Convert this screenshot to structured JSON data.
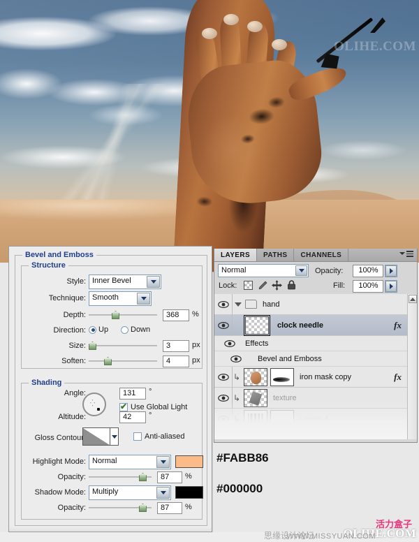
{
  "photo": {
    "description": "Desert landscape with blue cloudy sky and a rusted iron hand holding a black clock needle",
    "sky_color": "#5f7f9e",
    "sand_color": "#d2a579",
    "rust_color": "#b8743f"
  },
  "watermarks": {
    "top_right": "OLIHE.COM",
    "bottom_olihe": "OLIHE.COM",
    "bottom_huoli": "活力盒子",
    "bottom_missyuan": "WWW.MISSYUAN.COM",
    "bottom_siyuan": "思缘设计论坛"
  },
  "dialog": {
    "title": "Bevel and Emboss",
    "structure": {
      "title": "Structure",
      "style_label": "Style:",
      "style_value": "Inner Bevel",
      "technique_label": "Technique:",
      "technique_value": "Smooth",
      "depth_label": "Depth:",
      "depth_value": "368",
      "depth_unit": "%",
      "direction_label": "Direction:",
      "direction_up": "Up",
      "direction_down": "Down",
      "direction_selected": "Up",
      "size_label": "Size:",
      "size_value": "3",
      "size_unit": "px",
      "soften_label": "Soften:",
      "soften_value": "4",
      "soften_unit": "px"
    },
    "shading": {
      "title": "Shading",
      "angle_label": "Angle:",
      "angle_value": "131",
      "angle_unit": "°",
      "use_global_light_label": "Use Global Light",
      "use_global_light_checked": true,
      "altitude_label": "Altitude:",
      "altitude_value": "42",
      "altitude_unit": "°",
      "gloss_contour_label": "Gloss Contour:",
      "anti_aliased_label": "Anti-aliased",
      "anti_aliased_checked": false,
      "highlight_mode_label": "Highlight Mode:",
      "highlight_mode_value": "Normal",
      "highlight_color": "#FABB86",
      "highlight_color_hex": "#FABB86",
      "highlight_opacity_label": "Opacity:",
      "highlight_opacity_value": "87",
      "highlight_opacity_unit": "%",
      "shadow_mode_label": "Shadow Mode:",
      "shadow_mode_value": "Multiply",
      "shadow_color": "#000000",
      "shadow_color_hex": "#000000",
      "shadow_opacity_label": "Opacity:",
      "shadow_opacity_value": "87",
      "shadow_opacity_unit": "%"
    }
  },
  "layers_panel": {
    "tabs": [
      {
        "label": "LAYERS",
        "active": true
      },
      {
        "label": "PATHS",
        "active": false
      },
      {
        "label": "CHANNELS",
        "active": false
      }
    ],
    "blend_mode": "Normal",
    "opacity_label": "Opacity:",
    "opacity_value": "100%",
    "lock_label": "Lock:",
    "fill_label": "Fill:",
    "fill_value": "100%",
    "lock_icons": [
      "lock-transparent-pixels-icon",
      "lock-image-pixels-icon",
      "lock-position-icon",
      "lock-all-icon"
    ],
    "rows": [
      {
        "kind": "group",
        "name": "hand",
        "visible": true,
        "selected": false,
        "expanded": true
      },
      {
        "kind": "layer",
        "name": "clock needle",
        "visible": true,
        "selected": true,
        "has_fx": true,
        "thumb": "transparent"
      },
      {
        "kind": "effects",
        "name": "Effects",
        "visible": true
      },
      {
        "kind": "effect",
        "name": "Bevel and Emboss",
        "visible": true
      },
      {
        "kind": "layer",
        "name": "iron mask copy",
        "visible": true,
        "selected": false,
        "has_fx": true,
        "clipped": true,
        "thumb": "face",
        "mask": "brush"
      },
      {
        "kind": "layer",
        "name": "texture",
        "visible": true,
        "selected": false,
        "has_fx": false,
        "clipped": true,
        "thumb": "texture",
        "dim": true
      },
      {
        "kind": "layer",
        "name": "Levels 4",
        "visible": false,
        "selected": false,
        "clipped": true,
        "thumb": "histogram",
        "mask": "plain",
        "dim": true,
        "faded": true
      }
    ]
  }
}
